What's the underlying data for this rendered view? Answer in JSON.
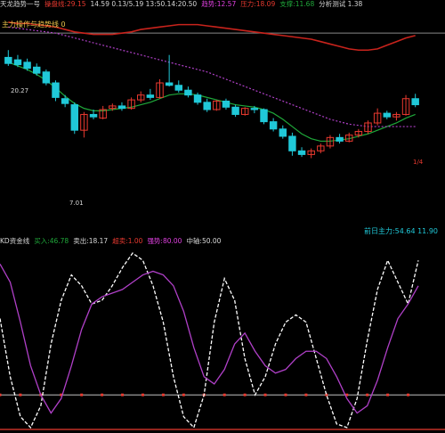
{
  "colors": {
    "background": "#000000",
    "bull": "#e8392f",
    "bear": "#20c8d8",
    "ma_green": "#1fa83a",
    "ma_yellow": "#e8c24a",
    "resistance_red": "#c8231c",
    "purple": "#b040c8",
    "white_line": "#ffffff",
    "baseline": "#c0c0c0"
  },
  "top_bar": {
    "segments": [
      {
        "text": "天龙趋势一号",
        "color": "#d8d8d8"
      },
      {
        "text": "操盘线:29.15",
        "color": "#e8392f"
      },
      {
        "text": "14.59 0.13/5.19 13:50.14:20.50",
        "color": "#d8d8d8"
      },
      {
        "text": "趋势:12.57",
        "color": "#e040e0"
      },
      {
        "text": "压力:18.09",
        "color": "#e8392f"
      },
      {
        "text": "支撑:11.68",
        "color": "#1fa83a"
      },
      {
        "text": "分析测试 1.38",
        "color": "#d8d8d8"
      }
    ]
  },
  "panel1": {
    "label": "主力操作与趋势线 0",
    "price_high_label": "20.27",
    "price_low_label": "7.01",
    "right_marker_label": "1/4"
  },
  "panel2": {
    "header_segments": [
      {
        "text": "KD资金线",
        "color": "#d8d8d8"
      },
      {
        "text": "买入:46.78",
        "color": "#1fa83a"
      },
      {
        "text": "卖出:18.17",
        "color": "#d8d8d8"
      },
      {
        "text": "超卖:1.00",
        "color": "#e8392f"
      },
      {
        "text": "强势:80.00",
        "color": "#e040e0"
      },
      {
        "text": "中轴:50.00",
        "color": "#d8d8d8"
      }
    ],
    "right_label": "前日主力:54.64 11.90",
    "right_label_color": "#20c8d8"
  },
  "chart_data": [
    {
      "type": "candlestick",
      "title": "主力操作与趋势线 0",
      "ylim": [
        6,
        22
      ],
      "candles": [
        {
          "o": 18.3,
          "h": 18.9,
          "l": 17.6,
          "c": 17.8
        },
        {
          "o": 18.1,
          "h": 18.5,
          "l": 17.5,
          "c": 17.7
        },
        {
          "o": 17.9,
          "h": 18.2,
          "l": 17.2,
          "c": 17.4
        },
        {
          "o": 17.5,
          "h": 17.8,
          "l": 16.8,
          "c": 17.0
        },
        {
          "o": 17.1,
          "h": 17.3,
          "l": 16.0,
          "c": 16.2
        },
        {
          "o": 16.2,
          "h": 16.4,
          "l": 14.7,
          "c": 15.0
        },
        {
          "o": 14.9,
          "h": 15.2,
          "l": 14.2,
          "c": 14.5
        },
        {
          "o": 14.4,
          "h": 14.6,
          "l": 12.0,
          "c": 12.3
        },
        {
          "o": 12.3,
          "h": 13.8,
          "l": 11.7,
          "c": 13.6
        },
        {
          "o": 13.6,
          "h": 14.0,
          "l": 13.2,
          "c": 13.4
        },
        {
          "o": 13.3,
          "h": 14.3,
          "l": 13.2,
          "c": 14.0
        },
        {
          "o": 14.1,
          "h": 14.5,
          "l": 13.9,
          "c": 14.3
        },
        {
          "o": 14.3,
          "h": 14.6,
          "l": 13.9,
          "c": 14.1
        },
        {
          "o": 14.1,
          "h": 15.0,
          "l": 14.0,
          "c": 14.8
        },
        {
          "o": 14.8,
          "h": 15.5,
          "l": 14.6,
          "c": 15.2
        },
        {
          "o": 15.2,
          "h": 15.7,
          "l": 14.8,
          "c": 15.0
        },
        {
          "o": 15.0,
          "h": 16.5,
          "l": 14.9,
          "c": 16.2
        },
        {
          "o": 16.2,
          "h": 18.5,
          "l": 15.9,
          "c": 16.0
        },
        {
          "o": 16.0,
          "h": 16.4,
          "l": 15.4,
          "c": 15.6
        },
        {
          "o": 15.6,
          "h": 15.9,
          "l": 15.0,
          "c": 15.2
        },
        {
          "o": 15.2,
          "h": 15.4,
          "l": 14.4,
          "c": 14.6
        },
        {
          "o": 14.6,
          "h": 14.9,
          "l": 13.8,
          "c": 14.0
        },
        {
          "o": 14.0,
          "h": 14.8,
          "l": 13.9,
          "c": 14.7
        },
        {
          "o": 14.7,
          "h": 14.9,
          "l": 14.0,
          "c": 14.2
        },
        {
          "o": 14.2,
          "h": 14.4,
          "l": 13.4,
          "c": 13.6
        },
        {
          "o": 13.6,
          "h": 14.2,
          "l": 13.5,
          "c": 14.1
        },
        {
          "o": 14.1,
          "h": 14.3,
          "l": 13.7,
          "c": 14.0
        },
        {
          "o": 14.0,
          "h": 14.1,
          "l": 12.8,
          "c": 13.0
        },
        {
          "o": 13.0,
          "h": 13.3,
          "l": 12.2,
          "c": 12.4
        },
        {
          "o": 12.4,
          "h": 12.7,
          "l": 11.6,
          "c": 11.8
        },
        {
          "o": 11.8,
          "h": 12.1,
          "l": 10.2,
          "c": 10.6
        },
        {
          "o": 10.6,
          "h": 10.9,
          "l": 10.1,
          "c": 10.3
        },
        {
          "o": 10.3,
          "h": 10.8,
          "l": 10.0,
          "c": 10.6
        },
        {
          "o": 10.6,
          "h": 11.2,
          "l": 10.4,
          "c": 11.0
        },
        {
          "o": 11.0,
          "h": 11.9,
          "l": 10.8,
          "c": 11.7
        },
        {
          "o": 11.7,
          "h": 12.0,
          "l": 11.2,
          "c": 11.4
        },
        {
          "o": 11.4,
          "h": 12.1,
          "l": 11.3,
          "c": 11.9
        },
        {
          "o": 11.9,
          "h": 12.4,
          "l": 11.7,
          "c": 12.2
        },
        {
          "o": 12.2,
          "h": 13.1,
          "l": 12.0,
          "c": 12.9
        },
        {
          "o": 12.9,
          "h": 14.1,
          "l": 12.7,
          "c": 13.7
        },
        {
          "o": 13.7,
          "h": 13.9,
          "l": 13.2,
          "c": 13.4
        },
        {
          "o": 13.4,
          "h": 13.8,
          "l": 13.1,
          "c": 13.6
        },
        {
          "o": 13.6,
          "h": 15.2,
          "l": 13.5,
          "c": 14.9
        },
        {
          "o": 14.9,
          "h": 15.3,
          "l": 14.2,
          "c": 14.4
        }
      ],
      "series": [
        {
          "name": "操盘线",
          "values": [
            17.9,
            17.6,
            17.3,
            16.9,
            16.4,
            15.8,
            15.1,
            14.5,
            14.1,
            13.9,
            13.9,
            14.0,
            14.1,
            14.2,
            14.4,
            14.6,
            14.9,
            15.2,
            15.3,
            15.3,
            15.2,
            15.0,
            14.8,
            14.6,
            14.4,
            14.3,
            14.2,
            14.0,
            13.7,
            13.2,
            12.6,
            12.0,
            11.6,
            11.4,
            11.4,
            11.5,
            11.6,
            11.8,
            12.0,
            12.3,
            12.6,
            12.9,
            13.3,
            13.6
          ]
        },
        {
          "name": "趋势",
          "values": [
            20.8,
            20.7,
            20.6,
            20.5,
            20.4,
            20.3,
            20.1,
            19.9,
            19.7,
            19.5,
            19.3,
            19.1,
            18.9,
            18.7,
            18.5,
            18.3,
            18.1,
            17.9,
            17.7,
            17.5,
            17.3,
            17.1,
            16.8,
            16.5,
            16.2,
            15.9,
            15.6,
            15.3,
            15.0,
            14.7,
            14.4,
            14.1,
            13.8,
            13.5,
            13.2,
            13.0,
            12.8,
            12.7,
            12.6,
            12.6,
            12.6,
            12.6,
            12.6,
            12.6
          ]
        },
        {
          "name": "压力",
          "values": [
            21.2,
            21.1,
            21.1,
            21.0,
            20.9,
            20.8,
            20.6,
            20.4,
            20.3,
            20.2,
            20.2,
            20.2,
            20.3,
            20.4,
            20.6,
            20.7,
            20.8,
            20.9,
            21.0,
            21.0,
            21.0,
            20.9,
            20.8,
            20.7,
            20.6,
            20.5,
            20.4,
            20.3,
            20.2,
            20.1,
            20.0,
            19.9,
            19.8,
            19.6,
            19.4,
            19.2,
            19.0,
            18.9,
            18.9,
            19.0,
            19.3,
            19.6,
            19.9,
            20.1
          ]
        }
      ]
    },
    {
      "type": "line",
      "title": "KD资金线",
      "ylim": [
        0,
        100
      ],
      "series": [
        {
          "name": "买入",
          "values": [
            62,
            30,
            8,
            2,
            14,
            48,
            72,
            86,
            80,
            70,
            72,
            80,
            90,
            98,
            94,
            80,
            60,
            30,
            8,
            2,
            20,
            60,
            84,
            72,
            40,
            20,
            30,
            48,
            60,
            64,
            60,
            40,
            20,
            4,
            2,
            18,
            50,
            78,
            94,
            82,
            70,
            94
          ]
        },
        {
          "name": "卖出",
          "values": [
            92,
            82,
            60,
            36,
            20,
            10,
            18,
            36,
            56,
            70,
            74,
            76,
            78,
            82,
            86,
            88,
            86,
            80,
            66,
            46,
            30,
            26,
            34,
            48,
            54,
            44,
            36,
            32,
            34,
            40,
            44,
            44,
            40,
            30,
            18,
            10,
            14,
            28,
            46,
            62,
            70,
            80
          ]
        }
      ],
      "reference_line": 20
    }
  ]
}
